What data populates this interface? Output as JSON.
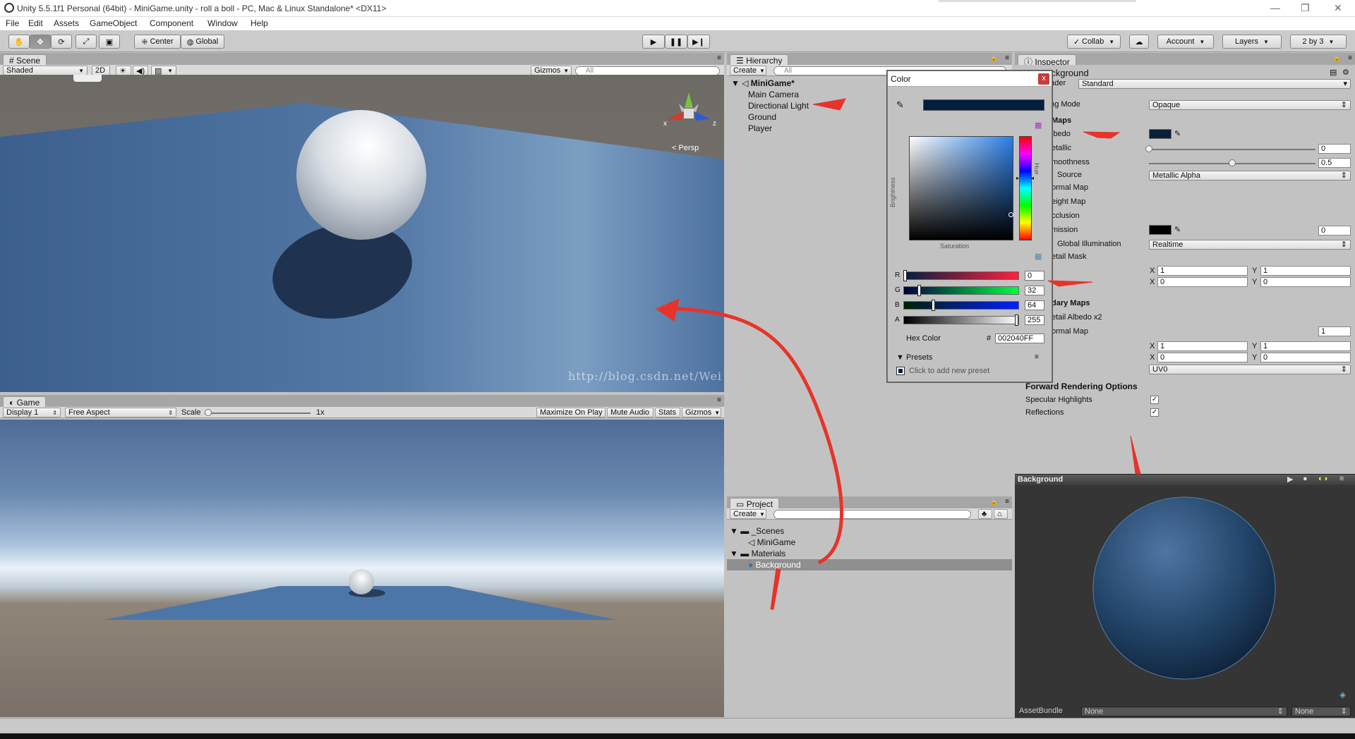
{
  "window": {
    "title": "Unity 5.5.1f1 Personal (64bit) - MiniGame.unity - roll a boll - PC, Mac & Linux Standalone* <DX11>"
  },
  "menu": [
    "File",
    "Edit",
    "Assets",
    "GameObject",
    "Component",
    "Window",
    "Help"
  ],
  "toolbar": {
    "pivot": "Center",
    "space": "Global",
    "collab": "Collab",
    "account": "Account",
    "layers": "Layers",
    "layout": "2 by 3"
  },
  "scene": {
    "tab": "Scene",
    "shading": "Shaded",
    "mode2d": "2D",
    "gizmos": "Gizmos",
    "search_placeholder": "All",
    "persp": "Persp",
    "axis_x": "x",
    "axis_y": "y",
    "axis_z": "z"
  },
  "game": {
    "tab": "Game",
    "display": "Display 1",
    "aspect": "Free Aspect",
    "scale_label": "Scale",
    "scale_value": "1x",
    "maximize": "Maximize On Play",
    "mute": "Mute Audio",
    "stats": "Stats",
    "gizmos": "Gizmos"
  },
  "hierarchy": {
    "tab": "Hierarchy",
    "create": "Create",
    "search_placeholder": "All",
    "scene_name": "MiniGame*",
    "items": [
      "Main Camera",
      "Directional Light",
      "Ground",
      "Player"
    ]
  },
  "project": {
    "tab": "Project",
    "create": "Create",
    "folders": [
      {
        "name": "_Scenes",
        "children": [
          "MiniGame"
        ]
      },
      {
        "name": "Materials",
        "children": [
          "Background"
        ]
      }
    ],
    "selected": "Background"
  },
  "color_picker": {
    "title": "Color",
    "close": "x",
    "swatch": "#002040",
    "brightness_label": "Brightness",
    "saturation_label": "Saturation",
    "hue_label": "Hue",
    "channels": [
      {
        "label": "R",
        "value": "0",
        "level": 0.0
      },
      {
        "label": "G",
        "value": "32",
        "level": 0.125
      },
      {
        "label": "B",
        "value": "64",
        "level": 0.25
      },
      {
        "label": "A",
        "value": "255",
        "level": 1.0
      }
    ],
    "hex_label": "Hex Color",
    "hex_prefix": "#",
    "hex_value": "002040FF",
    "presets_label": "Presets",
    "presets_hint": "Click to add new preset"
  },
  "watermark": "http://blog.csdn.net/Wei",
  "inspector": {
    "tab": "Inspector",
    "object_name": "ackground",
    "shader_label": "hader",
    "shader_value": "Standard",
    "rendering_mode_label": "ring Mode",
    "rendering_mode_value": "Opaque",
    "main_maps_label": "Maps",
    "albedo_label": "lbedo",
    "albedo_color": "#0b2037",
    "metallic_label": "etallic",
    "metallic_value": "0",
    "metallic_level": 0.0,
    "smoothness_label": "moothness",
    "smoothness_value": "0.5",
    "smoothness_level": 0.5,
    "source_label": "Source",
    "source_value": "Metallic Alpha",
    "normal_map_label": "ormal Map",
    "height_map_label": "eight Map",
    "occlusion_label": "cclusion",
    "emission_label": "mission",
    "emission_value": "0",
    "emission_color": "#000000",
    "gi_label": "Global Illumination",
    "gi_value": "Realtime",
    "detail_mask_label": "etail Mask",
    "tiling": {
      "x": "1",
      "y": "1"
    },
    "offset": {
      "x": "0",
      "y": "0"
    },
    "secondary_maps_label": "dary Maps",
    "detail_albedo_label": "etail Albedo x2",
    "detail_normal_label": "ormal Map",
    "detail_normal_value": "1",
    "tiling2": {
      "x": "1",
      "y": "1"
    },
    "offset2": {
      "x": "0",
      "y": "0"
    },
    "uv_value": "UV0",
    "forward_label": "Forward Rendering Options",
    "specular_label": "Specular Highlights",
    "specular_checked": "✓",
    "reflections_label": "Reflections",
    "reflections_checked": "✓",
    "lbl_x": "X",
    "lbl_y": "Y"
  },
  "preview": {
    "title": "Background",
    "assetbundle_label": "AssetBundle",
    "assetbundle_value": "None",
    "variant_value": "None"
  }
}
